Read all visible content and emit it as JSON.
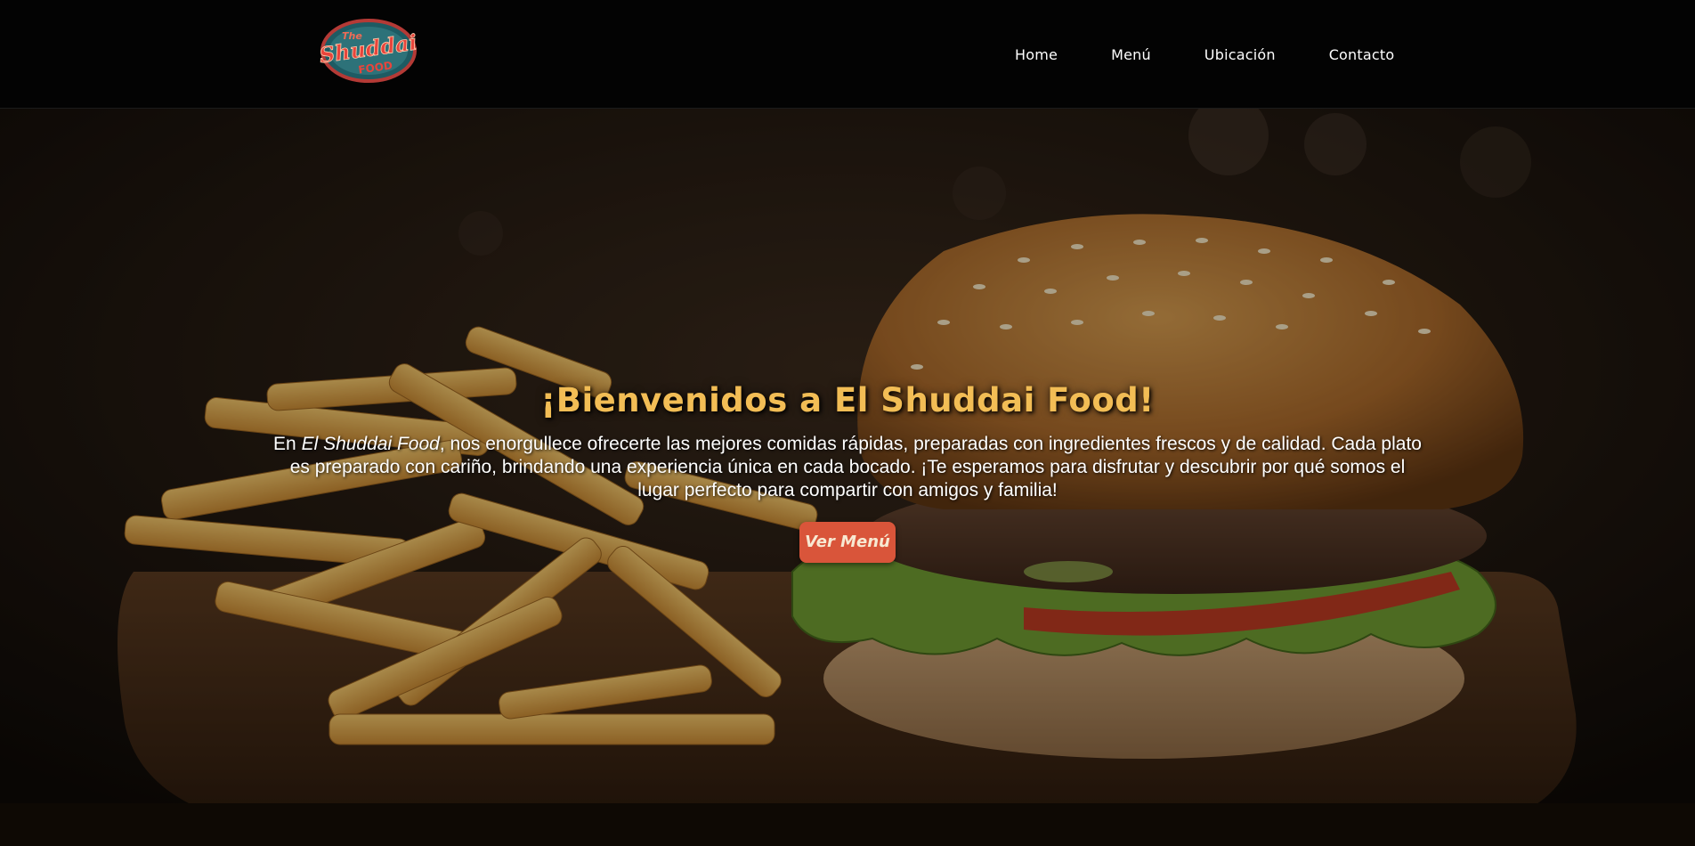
{
  "header": {
    "logo": {
      "name": "shuddai-food-logo",
      "text_top": "The",
      "text_main": "Shuddai",
      "text_bottom": "FOOD"
    },
    "nav": [
      {
        "label": "Home"
      },
      {
        "label": "Menú"
      },
      {
        "label": "Ubicación"
      },
      {
        "label": "Contacto"
      }
    ]
  },
  "hero": {
    "title": "¡Bienvenidos a El Shuddai Food!",
    "text_prefix": "En ",
    "text_brand": "El Shuddai Food",
    "text_body": ", nos enorgullece ofrecerte las mejores comidas rápidas, preparadas con ingredientes frescos y de calidad. Cada plato es preparado con cariño, brindando una experiencia única en cada bocado. ¡Te esperamos para disfrutar y descubrir por qué somos el lugar perfecto para compartir con amigos y familia!",
    "cta_label": "Ver Menú",
    "background": "burger-and-fries-photo"
  },
  "colors": {
    "header_bg": "#030303",
    "title": "#f2bd55",
    "cta_bg": "#d9553a",
    "cta_text": "#f7e9d2",
    "text": "#ffffff"
  }
}
